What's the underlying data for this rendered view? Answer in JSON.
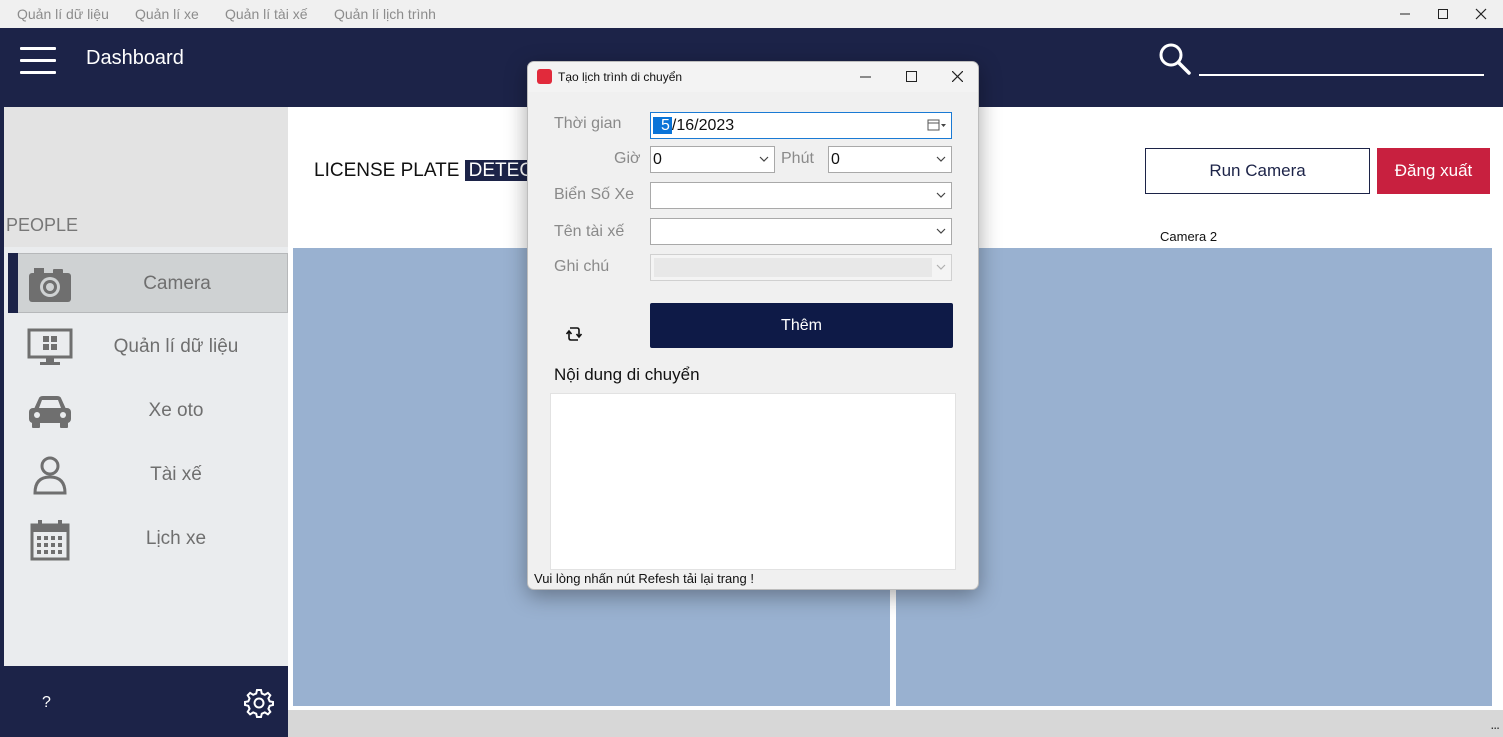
{
  "menubar": {
    "items": [
      "Quản lí dữ liệu",
      "Quản lí xe",
      "Quản lí tài xế",
      "Quản lí lịch trình"
    ]
  },
  "header": {
    "title": "Dashboard"
  },
  "sidebar": {
    "section_label": "PEOPLE",
    "items": [
      {
        "label": "Camera",
        "icon": "camera-icon",
        "active": true
      },
      {
        "label": "Quản lí dữ liệu",
        "icon": "monitor-windows-icon",
        "active": false
      },
      {
        "label": "Xe oto",
        "icon": "car-icon",
        "active": false
      },
      {
        "label": "Tài xế",
        "icon": "user-icon",
        "active": false
      },
      {
        "label": "Lịch xe",
        "icon": "calendar-icon",
        "active": false
      }
    ],
    "help_label": "?"
  },
  "main": {
    "title_plain": "LICENSE PLATE",
    "title_highlight": "DETECTIO",
    "run_camera_label": "Run Camera",
    "logout_label": "Đăng xuất",
    "camera2_label": "Camera 2",
    "statusbar_dots": "..."
  },
  "dialog": {
    "title": "Tạo lịch trình di chuyển",
    "time_label": "Thời gian",
    "date_month": "5",
    "date_rest": "/16/2023",
    "hour_label": "Giờ",
    "hour_value": "0",
    "minute_label": "Phút",
    "minute_value": "0",
    "plate_label": "Biển Số Xe",
    "plate_value": "",
    "driver_label": "Tên tài xế",
    "driver_value": "",
    "note_label": "Ghi chú",
    "note_value": "",
    "add_button": "Thêm",
    "content_label": "Nội dung di chuyển",
    "content_value": "",
    "hint": "Vui lòng nhấn nút Refesh tải lại trang !"
  },
  "colors": {
    "navy": "#1c2348",
    "dialog_button": "#0e1a47",
    "logout_red": "#c8203f",
    "camera_panel": "#99b1d0",
    "sidebar_bg": "#eaecee",
    "selection_blue": "#0a74d8"
  }
}
